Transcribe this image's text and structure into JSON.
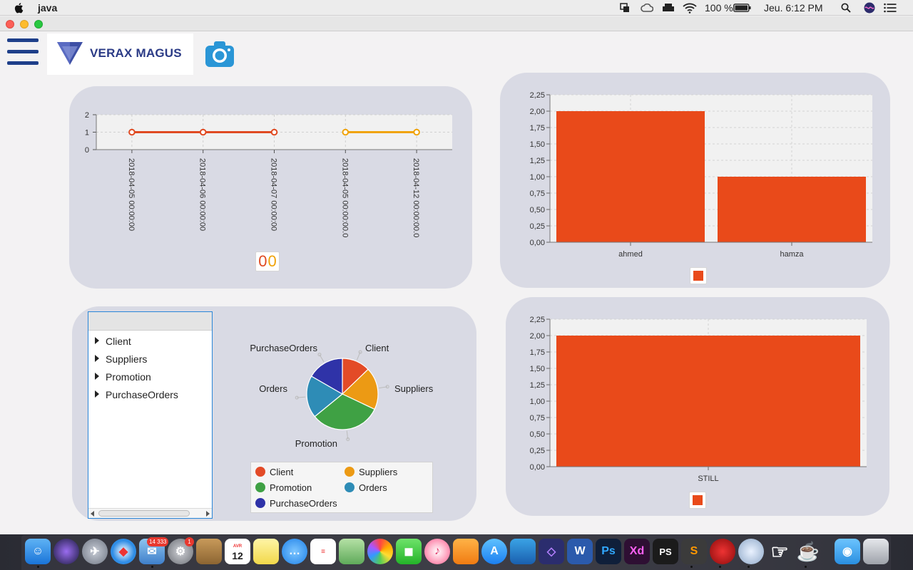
{
  "menubar": {
    "app_name": "java",
    "battery": "100 %",
    "clock": "Jeu. 6:12 PM"
  },
  "app": {
    "logo_text": "VERAX MAGUS"
  },
  "line_chart": {
    "stack_value_1": "0",
    "stack_value_2": "0"
  },
  "tree": {
    "items": [
      {
        "label": "Client"
      },
      {
        "label": "Suppliers"
      },
      {
        "label": "Promotion"
      },
      {
        "label": "PurchaseOrders"
      }
    ]
  },
  "pie_legend": {
    "items": [
      "Client",
      "Suppliers",
      "Promotion",
      "Orders",
      "PurchaseOrders"
    ]
  },
  "dock": {
    "badge_mail": "14 333",
    "badge_settings": "1",
    "calendar_month": "AVR",
    "calendar_day": "12"
  },
  "colors": {
    "bar": "#e94a1a",
    "series_red": "#e04a22",
    "series_orange": "#f0a30a",
    "pie_client": "#e34b27",
    "pie_suppliers": "#ec9a14",
    "pie_promotion": "#3fa144",
    "pie_orders": "#2e8cb6",
    "pie_purchaseorders": "#2f33a8",
    "panel": "#d9dae4"
  },
  "chart_data": [
    {
      "type": "line",
      "x": [
        "2018-04-05 00:00:00",
        "2018-04-06 00:00:00",
        "2018-04-07 00:00:00",
        "2018-04-05 00:00:00.0",
        "2018-04-12 00:00:00.0"
      ],
      "series": [
        {
          "values": [
            1,
            1,
            1,
            null,
            null
          ],
          "color": "#e04a22"
        },
        {
          "values": [
            null,
            null,
            null,
            1,
            1
          ],
          "color": "#f0a30a"
        }
      ],
      "yticks": [
        "0",
        "1",
        "2"
      ],
      "ylim": [
        0,
        2
      ],
      "grid": true
    },
    {
      "type": "bar",
      "categories": [
        "ahmed",
        "hamza"
      ],
      "values": [
        2,
        1
      ],
      "yticks": [
        "0,00",
        "0,25",
        "0,50",
        "0,75",
        "1,00",
        "1,25",
        "1,50",
        "1,75",
        "2,00",
        "2,25"
      ],
      "ylim": [
        0,
        2.25
      ],
      "grid": true
    },
    {
      "type": "pie",
      "categories": [
        "Client",
        "Suppliers",
        "Promotion",
        "Orders",
        "PurchaseOrders"
      ],
      "values": [
        1,
        1.5,
        2.5,
        1.5,
        1.3
      ]
    },
    {
      "type": "bar",
      "categories": [
        "STILL"
      ],
      "values": [
        2
      ],
      "yticks": [
        "0,00",
        "0,25",
        "0,50",
        "0,75",
        "1,00",
        "1,25",
        "1,50",
        "1,75",
        "2,00",
        "2,25"
      ],
      "ylim": [
        0,
        2.25
      ],
      "grid": true
    }
  ]
}
